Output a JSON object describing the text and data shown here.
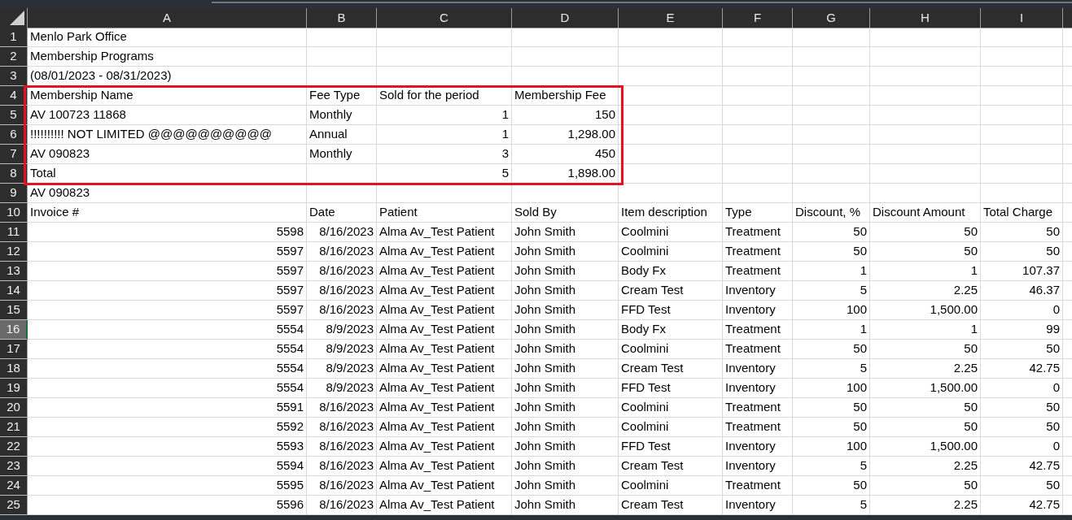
{
  "columns": [
    {
      "label": "A"
    },
    {
      "label": "B"
    },
    {
      "label": "C"
    },
    {
      "label": "D"
    },
    {
      "label": "E"
    },
    {
      "label": "F"
    },
    {
      "label": "G"
    },
    {
      "label": "H"
    },
    {
      "label": "I"
    }
  ],
  "rows": [
    {
      "number": "1",
      "selected": false,
      "cells": [
        {
          "text": "Menlo Park Office",
          "kind": "text"
        },
        null,
        null,
        null,
        null,
        null,
        null,
        null,
        null
      ]
    },
    {
      "number": "2",
      "selected": false,
      "cells": [
        {
          "text": "Membership Programs",
          "kind": "text"
        },
        null,
        null,
        null,
        null,
        null,
        null,
        null,
        null
      ]
    },
    {
      "number": "3",
      "selected": false,
      "cells": [
        {
          "text": "(08/01/2023 - 08/31/2023)",
          "kind": "text"
        },
        null,
        null,
        null,
        null,
        null,
        null,
        null,
        null
      ]
    },
    {
      "number": "4",
      "selected": false,
      "cells": [
        {
          "text": "Membership Name",
          "kind": "text"
        },
        {
          "text": "Fee Type",
          "kind": "text"
        },
        {
          "text": "Sold for the period",
          "kind": "text"
        },
        {
          "text": "Membership Fee",
          "kind": "text"
        },
        null,
        null,
        null,
        null,
        null
      ]
    },
    {
      "number": "5",
      "selected": false,
      "cells": [
        {
          "text": "AV 100723 11868",
          "kind": "text"
        },
        {
          "text": "Monthly",
          "kind": "text"
        },
        {
          "text": "1",
          "kind": "number"
        },
        {
          "text": "150",
          "kind": "number"
        },
        null,
        null,
        null,
        null,
        null
      ]
    },
    {
      "number": "6",
      "selected": false,
      "cells": [
        {
          "text": "!!!!!!!!!! NOT LIMITED @@@@@@@@@@",
          "kind": "text"
        },
        {
          "text": "Annual",
          "kind": "text"
        },
        {
          "text": "1",
          "kind": "number"
        },
        {
          "text": "1,298.00",
          "kind": "number"
        },
        null,
        null,
        null,
        null,
        null
      ]
    },
    {
      "number": "7",
      "selected": false,
      "cells": [
        {
          "text": "AV 090823",
          "kind": "text"
        },
        {
          "text": "Monthly",
          "kind": "text"
        },
        {
          "text": "3",
          "kind": "number"
        },
        {
          "text": "450",
          "kind": "number"
        },
        null,
        null,
        null,
        null,
        null
      ]
    },
    {
      "number": "8",
      "selected": false,
      "cells": [
        {
          "text": "Total",
          "kind": "text"
        },
        null,
        {
          "text": "5",
          "kind": "number"
        },
        {
          "text": "1,898.00",
          "kind": "number"
        },
        null,
        null,
        null,
        null,
        null
      ]
    },
    {
      "number": "9",
      "selected": false,
      "cells": [
        {
          "text": "AV 090823",
          "kind": "text"
        },
        null,
        null,
        null,
        null,
        null,
        null,
        null,
        null
      ]
    },
    {
      "number": "10",
      "selected": false,
      "cells": [
        {
          "text": "Invoice #",
          "kind": "text"
        },
        {
          "text": "Date",
          "kind": "text"
        },
        {
          "text": "Patient",
          "kind": "text"
        },
        {
          "text": "Sold By",
          "kind": "text"
        },
        {
          "text": "Item description",
          "kind": "text"
        },
        {
          "text": "Type",
          "kind": "text"
        },
        {
          "text": "Discount, %",
          "kind": "text"
        },
        {
          "text": "Discount Amount",
          "kind": "text"
        },
        {
          "text": "Total Charge",
          "kind": "text"
        }
      ]
    },
    {
      "number": "11",
      "selected": false,
      "cells": [
        {
          "text": "5598",
          "kind": "number"
        },
        {
          "text": "8/16/2023",
          "kind": "number"
        },
        {
          "text": "Alma Av_Test Patient",
          "kind": "text"
        },
        {
          "text": "John Smith",
          "kind": "text"
        },
        {
          "text": "Coolmini",
          "kind": "text"
        },
        {
          "text": "Treatment",
          "kind": "text"
        },
        {
          "text": "50",
          "kind": "number"
        },
        {
          "text": "50",
          "kind": "number"
        },
        {
          "text": "50",
          "kind": "number"
        }
      ]
    },
    {
      "number": "12",
      "selected": false,
      "cells": [
        {
          "text": "5597",
          "kind": "number"
        },
        {
          "text": "8/16/2023",
          "kind": "number"
        },
        {
          "text": "Alma Av_Test Patient",
          "kind": "text"
        },
        {
          "text": "John Smith",
          "kind": "text"
        },
        {
          "text": "Coolmini",
          "kind": "text"
        },
        {
          "text": "Treatment",
          "kind": "text"
        },
        {
          "text": "50",
          "kind": "number"
        },
        {
          "text": "50",
          "kind": "number"
        },
        {
          "text": "50",
          "kind": "number"
        }
      ]
    },
    {
      "number": "13",
      "selected": false,
      "cells": [
        {
          "text": "5597",
          "kind": "number"
        },
        {
          "text": "8/16/2023",
          "kind": "number"
        },
        {
          "text": "Alma Av_Test Patient",
          "kind": "text"
        },
        {
          "text": "John Smith",
          "kind": "text"
        },
        {
          "text": "Body Fx",
          "kind": "text"
        },
        {
          "text": "Treatment",
          "kind": "text"
        },
        {
          "text": "1",
          "kind": "number"
        },
        {
          "text": "1",
          "kind": "number"
        },
        {
          "text": "107.37",
          "kind": "number"
        }
      ]
    },
    {
      "number": "14",
      "selected": false,
      "cells": [
        {
          "text": "5597",
          "kind": "number"
        },
        {
          "text": "8/16/2023",
          "kind": "number"
        },
        {
          "text": "Alma Av_Test Patient",
          "kind": "text"
        },
        {
          "text": "John Smith",
          "kind": "text"
        },
        {
          "text": "Cream Test",
          "kind": "text"
        },
        {
          "text": "Inventory",
          "kind": "text"
        },
        {
          "text": "5",
          "kind": "number"
        },
        {
          "text": "2.25",
          "kind": "number"
        },
        {
          "text": "46.37",
          "kind": "number"
        }
      ]
    },
    {
      "number": "15",
      "selected": false,
      "cells": [
        {
          "text": "5597",
          "kind": "number"
        },
        {
          "text": "8/16/2023",
          "kind": "number"
        },
        {
          "text": "Alma Av_Test Patient",
          "kind": "text"
        },
        {
          "text": "John Smith",
          "kind": "text"
        },
        {
          "text": "FFD Test",
          "kind": "text"
        },
        {
          "text": "Inventory",
          "kind": "text"
        },
        {
          "text": "100",
          "kind": "number"
        },
        {
          "text": "1,500.00",
          "kind": "number"
        },
        {
          "text": "0",
          "kind": "number"
        }
      ]
    },
    {
      "number": "16",
      "selected": true,
      "cells": [
        {
          "text": "5554",
          "kind": "number"
        },
        {
          "text": "8/9/2023",
          "kind": "number"
        },
        {
          "text": "Alma Av_Test Patient",
          "kind": "text"
        },
        {
          "text": "John Smith",
          "kind": "text"
        },
        {
          "text": "Body Fx",
          "kind": "text"
        },
        {
          "text": "Treatment",
          "kind": "text"
        },
        {
          "text": "1",
          "kind": "number"
        },
        {
          "text": "1",
          "kind": "number"
        },
        {
          "text": "99",
          "kind": "number"
        }
      ]
    },
    {
      "number": "17",
      "selected": false,
      "cells": [
        {
          "text": "5554",
          "kind": "number"
        },
        {
          "text": "8/9/2023",
          "kind": "number"
        },
        {
          "text": "Alma Av_Test Patient",
          "kind": "text"
        },
        {
          "text": "John Smith",
          "kind": "text"
        },
        {
          "text": "Coolmini",
          "kind": "text"
        },
        {
          "text": "Treatment",
          "kind": "text"
        },
        {
          "text": "50",
          "kind": "number"
        },
        {
          "text": "50",
          "kind": "number"
        },
        {
          "text": "50",
          "kind": "number"
        }
      ]
    },
    {
      "number": "18",
      "selected": false,
      "cells": [
        {
          "text": "5554",
          "kind": "number"
        },
        {
          "text": "8/9/2023",
          "kind": "number"
        },
        {
          "text": "Alma Av_Test Patient",
          "kind": "text"
        },
        {
          "text": "John Smith",
          "kind": "text"
        },
        {
          "text": "Cream Test",
          "kind": "text"
        },
        {
          "text": "Inventory",
          "kind": "text"
        },
        {
          "text": "5",
          "kind": "number"
        },
        {
          "text": "2.25",
          "kind": "number"
        },
        {
          "text": "42.75",
          "kind": "number"
        }
      ]
    },
    {
      "number": "19",
      "selected": false,
      "cells": [
        {
          "text": "5554",
          "kind": "number"
        },
        {
          "text": "8/9/2023",
          "kind": "number"
        },
        {
          "text": "Alma Av_Test Patient",
          "kind": "text"
        },
        {
          "text": "John Smith",
          "kind": "text"
        },
        {
          "text": "FFD Test",
          "kind": "text"
        },
        {
          "text": "Inventory",
          "kind": "text"
        },
        {
          "text": "100",
          "kind": "number"
        },
        {
          "text": "1,500.00",
          "kind": "number"
        },
        {
          "text": "0",
          "kind": "number"
        }
      ]
    },
    {
      "number": "20",
      "selected": false,
      "cells": [
        {
          "text": "5591",
          "kind": "number"
        },
        {
          "text": "8/16/2023",
          "kind": "number"
        },
        {
          "text": "Alma Av_Test Patient",
          "kind": "text"
        },
        {
          "text": "John Smith",
          "kind": "text"
        },
        {
          "text": "Coolmini",
          "kind": "text"
        },
        {
          "text": "Treatment",
          "kind": "text"
        },
        {
          "text": "50",
          "kind": "number"
        },
        {
          "text": "50",
          "kind": "number"
        },
        {
          "text": "50",
          "kind": "number"
        }
      ]
    },
    {
      "number": "21",
      "selected": false,
      "cells": [
        {
          "text": "5592",
          "kind": "number"
        },
        {
          "text": "8/16/2023",
          "kind": "number"
        },
        {
          "text": "Alma Av_Test Patient",
          "kind": "text"
        },
        {
          "text": "John Smith",
          "kind": "text"
        },
        {
          "text": "Coolmini",
          "kind": "text"
        },
        {
          "text": "Treatment",
          "kind": "text"
        },
        {
          "text": "50",
          "kind": "number"
        },
        {
          "text": "50",
          "kind": "number"
        },
        {
          "text": "50",
          "kind": "number"
        }
      ]
    },
    {
      "number": "22",
      "selected": false,
      "cells": [
        {
          "text": "5593",
          "kind": "number"
        },
        {
          "text": "8/16/2023",
          "kind": "number"
        },
        {
          "text": "Alma Av_Test Patient",
          "kind": "text"
        },
        {
          "text": "John Smith",
          "kind": "text"
        },
        {
          "text": "FFD Test",
          "kind": "text"
        },
        {
          "text": "Inventory",
          "kind": "text"
        },
        {
          "text": "100",
          "kind": "number"
        },
        {
          "text": "1,500.00",
          "kind": "number"
        },
        {
          "text": "0",
          "kind": "number"
        }
      ]
    },
    {
      "number": "23",
      "selected": false,
      "cells": [
        {
          "text": "5594",
          "kind": "number"
        },
        {
          "text": "8/16/2023",
          "kind": "number"
        },
        {
          "text": "Alma Av_Test Patient",
          "kind": "text"
        },
        {
          "text": "John Smith",
          "kind": "text"
        },
        {
          "text": "Cream Test",
          "kind": "text"
        },
        {
          "text": "Inventory",
          "kind": "text"
        },
        {
          "text": "5",
          "kind": "number"
        },
        {
          "text": "2.25",
          "kind": "number"
        },
        {
          "text": "42.75",
          "kind": "number"
        }
      ]
    },
    {
      "number": "24",
      "selected": false,
      "cells": [
        {
          "text": "5595",
          "kind": "number"
        },
        {
          "text": "8/16/2023",
          "kind": "number"
        },
        {
          "text": "Alma Av_Test Patient",
          "kind": "text"
        },
        {
          "text": "John Smith",
          "kind": "text"
        },
        {
          "text": "Coolmini",
          "kind": "text"
        },
        {
          "text": "Treatment",
          "kind": "text"
        },
        {
          "text": "50",
          "kind": "number"
        },
        {
          "text": "50",
          "kind": "number"
        },
        {
          "text": "50",
          "kind": "number"
        }
      ]
    },
    {
      "number": "25",
      "selected": false,
      "cells": [
        {
          "text": "5596",
          "kind": "number"
        },
        {
          "text": "8/16/2023",
          "kind": "number"
        },
        {
          "text": "Alma Av_Test Patient",
          "kind": "text"
        },
        {
          "text": "John Smith",
          "kind": "text"
        },
        {
          "text": "Cream Test",
          "kind": "text"
        },
        {
          "text": "Inventory",
          "kind": "text"
        },
        {
          "text": "5",
          "kind": "number"
        },
        {
          "text": "2.25",
          "kind": "number"
        },
        {
          "text": "42.75",
          "kind": "number"
        }
      ]
    }
  ]
}
